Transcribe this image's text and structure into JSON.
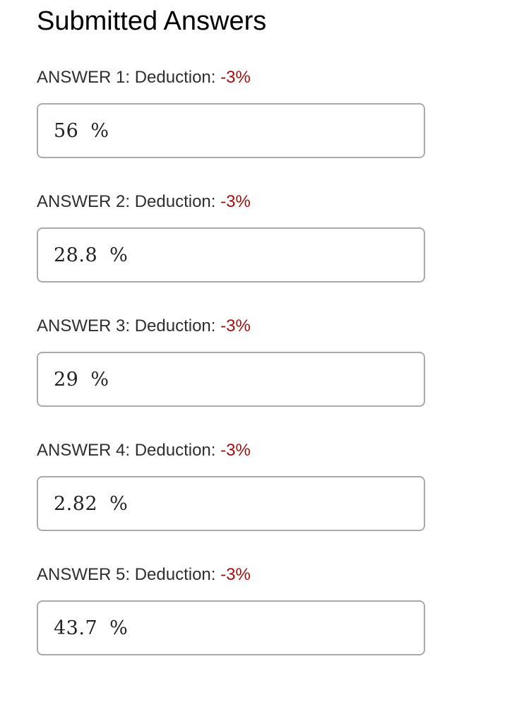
{
  "page_title": "Submitted Answers",
  "answers": [
    {
      "label": "ANSWER 1: Deduction:",
      "deduction": "-3%",
      "value": "56",
      "unit": "%"
    },
    {
      "label": "ANSWER 2: Deduction:",
      "deduction": "-3%",
      "value": "28.8",
      "unit": "%"
    },
    {
      "label": "ANSWER 3: Deduction:",
      "deduction": "-3%",
      "value": "29",
      "unit": "%"
    },
    {
      "label": "ANSWER 4: Deduction:",
      "deduction": "-3%",
      "value": "2.82",
      "unit": "%"
    },
    {
      "label": "ANSWER 5: Deduction:",
      "deduction": "-3%",
      "value": "43.7",
      "unit": "%"
    }
  ],
  "colors": {
    "deduction": "#a50e0e",
    "border": "#aaaaaa"
  }
}
